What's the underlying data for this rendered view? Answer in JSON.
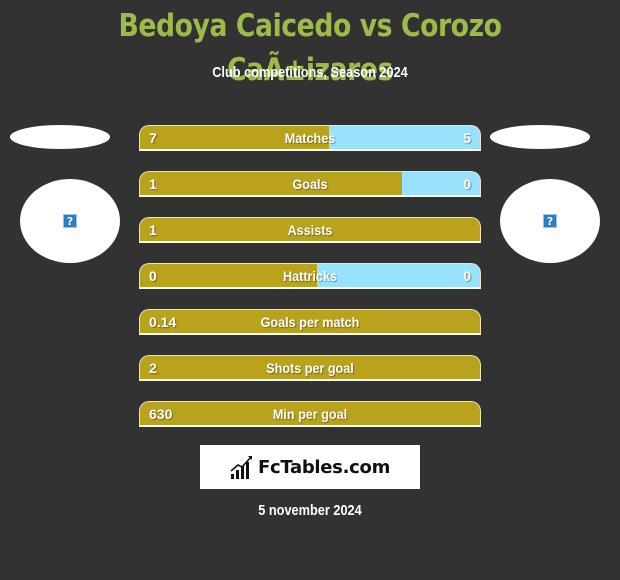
{
  "header": {
    "title": "Bedoya Caicedo vs Corozo CaÃ±izares",
    "subtitle": "Club competitions, Season 2024"
  },
  "players": {
    "left": {
      "image_icon": "broken-image-icon",
      "image_glyph": "?"
    },
    "right": {
      "image_icon": "broken-image-icon",
      "image_glyph": "?"
    }
  },
  "colors": {
    "background": "#323232",
    "title": "#9cbc4a",
    "left_bar": "#b9a21c",
    "right_bar": "#98e2fb"
  },
  "stats": [
    {
      "label": "Matches",
      "left": "7",
      "right": "5",
      "left_share": 0.556
    },
    {
      "label": "Goals",
      "left": "1",
      "right": "0",
      "left_share": 0.77
    },
    {
      "label": "Assists",
      "left": "1",
      "right": "",
      "left_share": 1.0
    },
    {
      "label": "Hattricks",
      "left": "0",
      "right": "0",
      "left_share": 0.52
    },
    {
      "label": "Goals per match",
      "left": "0.14",
      "right": "",
      "left_share": 1.0
    },
    {
      "label": "Shots per goal",
      "left": "2",
      "right": "",
      "left_share": 1.0
    },
    {
      "label": "Min per goal",
      "left": "630",
      "right": "",
      "left_share": 1.0
    }
  ],
  "footer": {
    "logo_text": "FcTables.com",
    "logo_icon": "bar-chart-icon",
    "date": "5 november 2024"
  }
}
